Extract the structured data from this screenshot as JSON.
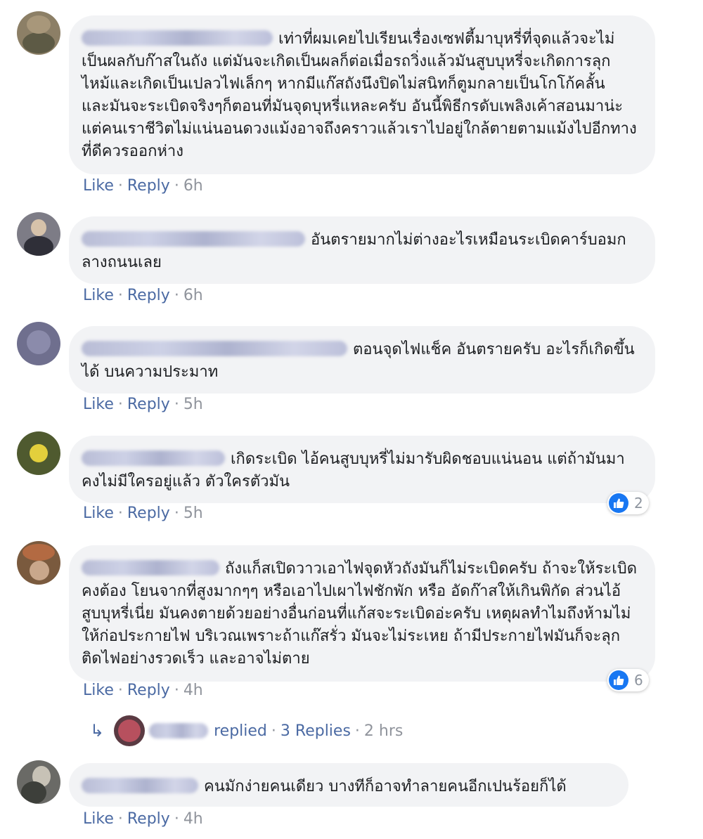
{
  "comments": [
    {
      "text": "เท่าที่ผมเคยไปเรียนเรื่องเซฟตี้มาบุหรี่ที่จุดแล้วจะไม่เป็นผลกับก๊าสในถัง แต่มันจะเกิดเป็นผลก็ต่อเมื่อรถวิ่งแล้วมันสูบบุหรี่จะเกิดการลุกไหม้และเกิดเป็นเปลวไฟเล็กๆ หากมีแก๊สถังนึงปิดไม่สนิทก็ตูมกลายเป็นโกโก้คลั้น และมันจะระเบิดจริงๆก็ตอนที่มันจุดบุหรี่แหละครับ อันนี้พิธีกรดับเพลิงเค้าสอนมาน่ะ แต่คนเราชีวิตไม่แน่นอนดวงแม้งอาจถึงคราวแล้วเราไปอยู่ใกล้ตายตามแม้งไปอีกทางที่ดีควรออกห่าง",
      "like": "Like",
      "reply": "Reply",
      "time": "6h"
    },
    {
      "text": "อันตรายมากไม่ต่างอะไรเหมือนระเบิดคาร์บอมกลางถนนเลย",
      "like": "Like",
      "reply": "Reply",
      "time": "6h"
    },
    {
      "text": "ตอนจุดไฟแช็ค อันตรายครับ อะไรก็เกิดขึ้นได้ บนความประมาท",
      "like": "Like",
      "reply": "Reply",
      "time": "5h"
    },
    {
      "text": "เกิดระเบิด ไอ้คนสูบบุหรี่ไม่มารับผิดชอบแน่นอน แต่ถ้ามันมาคงไม่มีใครอยู่แล้ว ตัวใครตัวมัน",
      "like": "Like",
      "reply": "Reply",
      "time": "5h",
      "reactions": "2"
    },
    {
      "text": "ถังแก็สเปิดวาวเอาไฟจุดหัวถังมันก็ไม่ระเบิดครับ ถ้าจะให้ระเบิด คงต้อง โยนจากที่สูงมากๆๆ หรือเอาไปเผาไฟชักพัก หรือ อัดก๊าสให้เกินพิกัด ส่วนไอ้สูบบุหรี่เนี่ย มันคงตายด้วยอย่างอื่นก่อนที่แก้สจะระเบิดอ่ะครับ เหตุผลทำไมถึงห้ามไม่ให้ก่อประกายไฟ บริเวณเพราะถ้าแก๊สรั่ว มันจะไม่ระเหย ถ้ามีประกายไฟมันก็จะลุกติดไฟอย่างรวดเร็ว และอาจไม่ตาย",
      "like": "Like",
      "reply": "Reply",
      "time": "4h",
      "reactions": "6"
    },
    {
      "text": "คนมักง่ายคนเดียว บางทีก็อาจทำลายคนอีกเปนร้อยก็ได้",
      "like": "Like",
      "reply": "Reply",
      "time": "4h"
    }
  ],
  "replies_thread": {
    "replied": "replied",
    "count_label": "3 Replies",
    "time": "2 hrs"
  },
  "colors": {
    "bubble": "#f2f3f5",
    "link": "#4b6aa3",
    "meta": "#90949c",
    "like_blue": "#1877f2"
  },
  "icons": [
    "like-icon",
    "reply-arrow-icon"
  ]
}
